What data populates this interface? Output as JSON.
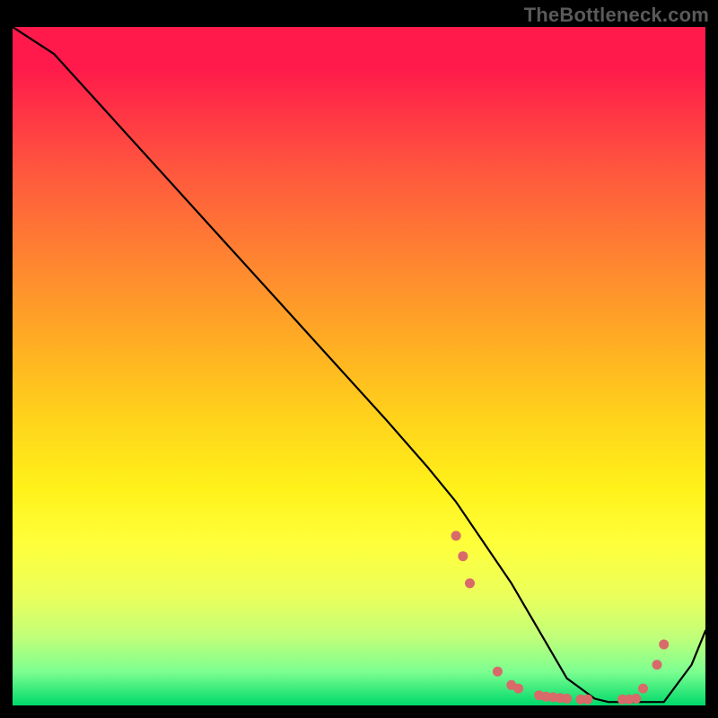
{
  "watermark": "TheBottleneck.com",
  "chart_data": {
    "type": "line",
    "title": "",
    "xlabel": "",
    "ylabel": "",
    "xlim": [
      0,
      100
    ],
    "ylim": [
      0,
      100
    ],
    "series": [
      {
        "name": "bottleneck-curve",
        "x": [
          0,
          6,
          14,
          22,
          30,
          38,
          46,
          54,
          60,
          64,
          68,
          72,
          76,
          80,
          84,
          86,
          90,
          94,
          98,
          100
        ],
        "y": [
          100,
          96,
          87,
          78,
          69,
          60,
          51,
          42,
          35,
          30,
          24,
          18,
          11,
          4,
          1,
          0.5,
          0.5,
          0.5,
          6,
          11
        ]
      }
    ],
    "markers": {
      "name": "valley-markers",
      "color": "#d86a6a",
      "x": [
        64,
        65,
        66,
        70,
        72,
        73,
        76,
        77,
        78,
        79,
        80,
        82,
        83,
        88,
        89,
        90,
        91,
        93,
        94
      ],
      "y": [
        25,
        22,
        18,
        5,
        3,
        2.5,
        1.5,
        1.3,
        1.2,
        1.1,
        1,
        0.9,
        0.9,
        0.9,
        0.9,
        1,
        2.5,
        6,
        9
      ]
    },
    "gradient_stops": [
      {
        "pos": 0.0,
        "color": "#ff1a4b"
      },
      {
        "pos": 0.06,
        "color": "#ff1a4b"
      },
      {
        "pos": 0.22,
        "color": "#ff5a3d"
      },
      {
        "pos": 0.36,
        "color": "#ff8a2f"
      },
      {
        "pos": 0.48,
        "color": "#ffb222"
      },
      {
        "pos": 0.58,
        "color": "#ffd41b"
      },
      {
        "pos": 0.68,
        "color": "#fff11a"
      },
      {
        "pos": 0.76,
        "color": "#ffff3a"
      },
      {
        "pos": 0.84,
        "color": "#eaff5c"
      },
      {
        "pos": 0.9,
        "color": "#c0ff7a"
      },
      {
        "pos": 0.95,
        "color": "#7dff90"
      },
      {
        "pos": 1.0,
        "color": "#00d96b"
      }
    ]
  }
}
